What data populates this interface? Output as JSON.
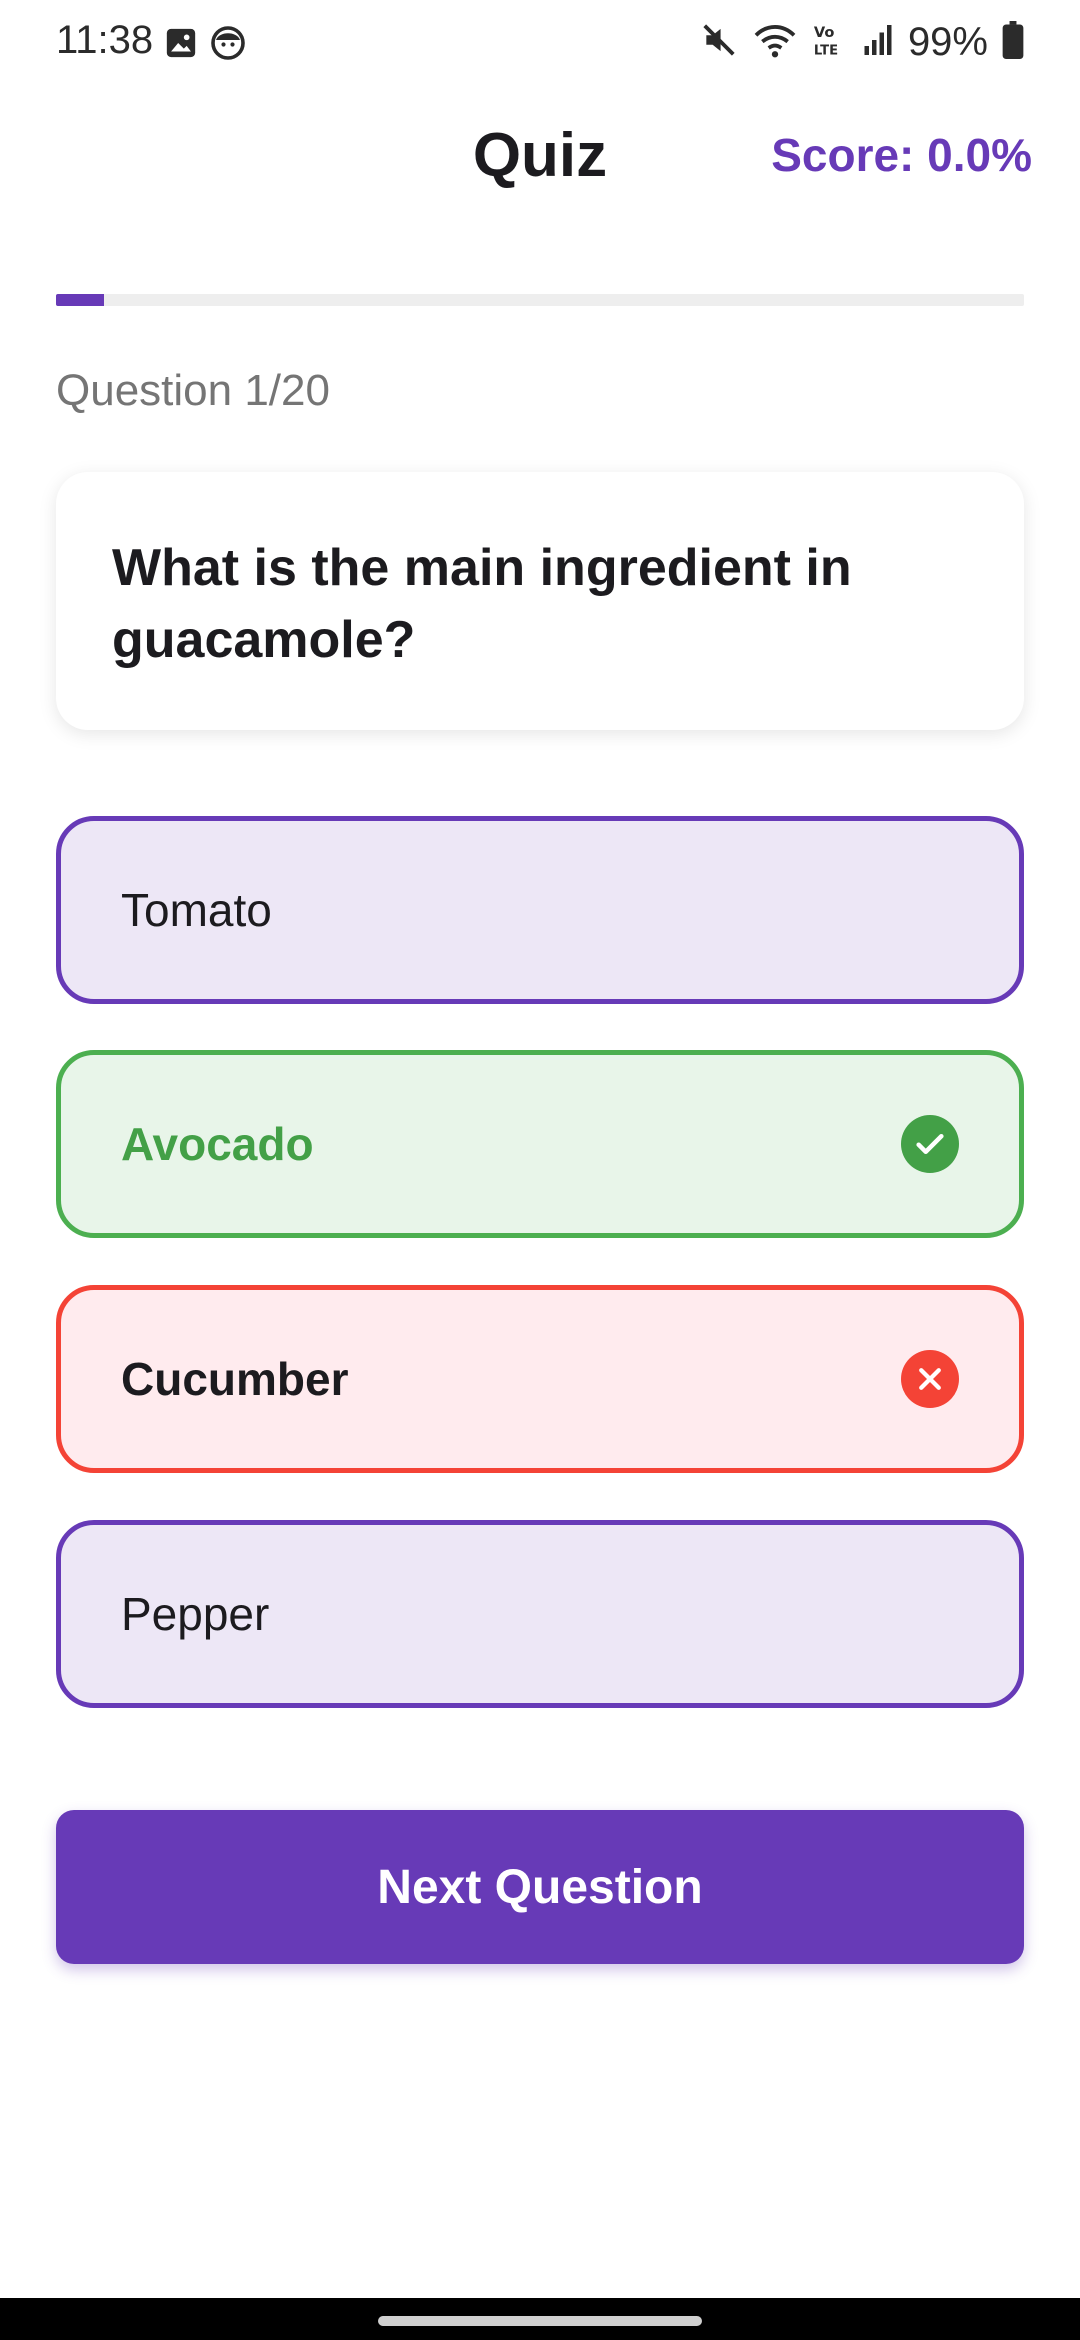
{
  "status_bar": {
    "time": "11:38",
    "battery": "99%",
    "icons": [
      "image-icon",
      "face-icon",
      "mute-icon",
      "wifi-icon",
      "volte-icon",
      "signal-icon",
      "battery-icon"
    ]
  },
  "app_bar": {
    "title": "Quiz",
    "score": "Score: 0.0%"
  },
  "progress": {
    "fraction": 0.05
  },
  "question": {
    "counter": "Question 1/20",
    "text": "What is the main ingredient in guacamole?"
  },
  "options": [
    {
      "label": "Tomato",
      "state": "default"
    },
    {
      "label": "Avocado",
      "state": "correct",
      "icon": "check-icon"
    },
    {
      "label": "Cucumber",
      "state": "wrong",
      "icon": "close-icon"
    },
    {
      "label": "Pepper",
      "state": "default"
    }
  ],
  "next_button": {
    "label": "Next Question"
  },
  "colors": {
    "accent": "#673ab7",
    "correct": "#4caf50",
    "wrong": "#f44336",
    "option_bg": "#ede7f6"
  }
}
